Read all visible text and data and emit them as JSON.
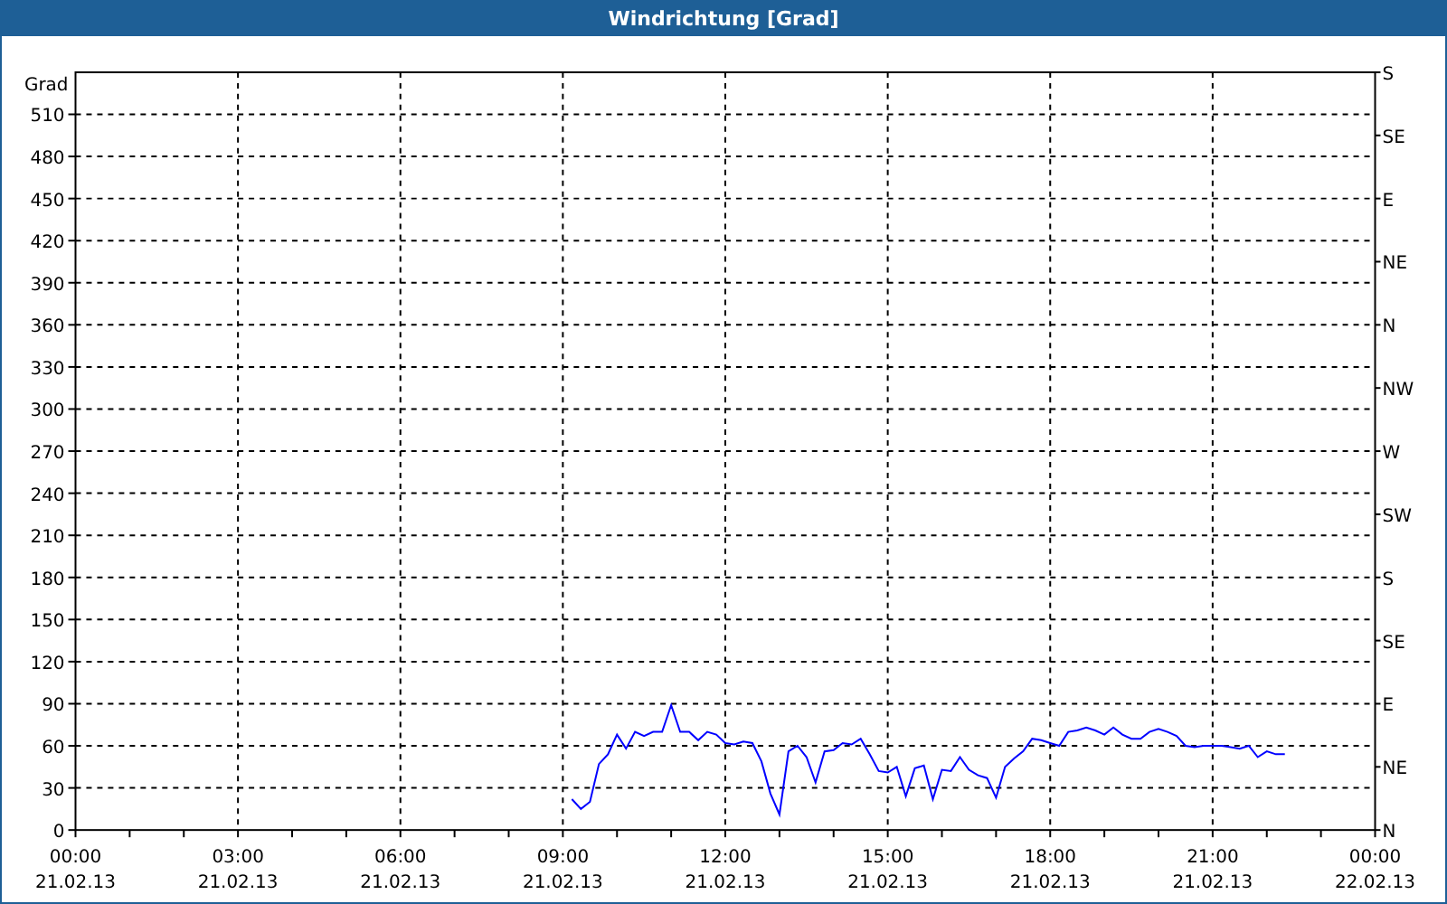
{
  "window": {
    "title": "Windrichtung [Grad]"
  },
  "chart": {
    "chart_data": {
      "type": "line",
      "ylabel": "Grad",
      "categories": [
        "00:00\n21.02.13",
        null,
        null,
        null,
        null,
        null,
        null,
        null,
        null,
        null,
        null,
        null,
        null,
        null,
        null,
        null,
        null,
        null,
        "03:00\n21.02.13",
        null,
        null,
        null,
        null,
        null,
        null,
        null,
        null,
        null,
        null,
        null,
        null,
        null,
        null,
        null,
        null,
        null,
        "06:00\n21.02.13",
        null,
        null,
        null,
        null,
        null,
        null,
        null,
        null,
        null,
        null,
        null,
        null,
        null,
        null,
        null,
        null,
        null,
        "09:00\n21.02.13",
        null,
        null,
        null,
        null,
        null,
        null,
        null,
        null,
        null,
        null,
        null,
        null,
        null,
        null,
        null,
        null,
        null,
        "12:00\n21.02.13",
        null,
        null,
        null,
        null,
        null,
        null,
        null,
        null,
        null,
        null,
        null,
        null,
        null,
        null,
        null,
        null,
        null,
        "15:00\n21.02.13",
        null,
        null,
        null,
        null,
        null,
        null,
        null,
        null,
        null,
        null,
        null,
        null,
        null,
        null,
        null,
        null,
        null,
        "18:00\n21.02.13",
        null,
        null,
        null,
        null,
        null,
        null,
        null,
        null,
        null,
        null,
        null,
        null,
        null,
        null,
        null,
        null,
        null,
        "21:00\n21.02.13",
        null,
        null,
        null,
        null,
        null,
        null,
        null,
        null,
        null,
        null,
        null,
        null,
        null,
        null,
        null,
        null,
        null,
        "00:00\n22.02.13"
      ],
      "series": [
        {
          "color": "#0000ff",
          "values": [
            null,
            null,
            null,
            null,
            null,
            null,
            null,
            null,
            null,
            null,
            null,
            null,
            null,
            null,
            null,
            null,
            null,
            null,
            null,
            null,
            null,
            null,
            null,
            null,
            null,
            null,
            null,
            null,
            null,
            null,
            null,
            null,
            null,
            null,
            null,
            null,
            null,
            null,
            null,
            null,
            null,
            null,
            null,
            null,
            null,
            null,
            null,
            null,
            null,
            null,
            null,
            null,
            null,
            null,
            null,
            22,
            15,
            20,
            47,
            54,
            68,
            58,
            70,
            67,
            70,
            70,
            89,
            70,
            70,
            64,
            70,
            68,
            62,
            61,
            63,
            62,
            49,
            26,
            11,
            56,
            60,
            52,
            34,
            56,
            57,
            62,
            61,
            65,
            54,
            42,
            41,
            45,
            24,
            44,
            46,
            22,
            43,
            42,
            52,
            43,
            39,
            37,
            23,
            45,
            51,
            56,
            65,
            64,
            62,
            60,
            70,
            71,
            73,
            71,
            68,
            73,
            68,
            65,
            65,
            70,
            72,
            70,
            67,
            60,
            59,
            60,
            60,
            60,
            59,
            58,
            60,
            52,
            56,
            54,
            54,
            null,
            null,
            null,
            null,
            null,
            null,
            null,
            null,
            null,
            null
          ]
        }
      ],
      "grid": true,
      "ylim": [
        0,
        540
      ],
      "yticks": [
        0,
        30,
        60,
        90,
        120,
        150,
        180,
        210,
        240,
        270,
        300,
        330,
        360,
        390,
        420,
        450,
        480,
        510
      ]
    },
    "right_axis": [
      "S",
      "SE",
      "E",
      "NE",
      "N",
      "NW",
      "W",
      "SW",
      "S",
      "SE",
      "E",
      "NE",
      "N"
    ]
  }
}
